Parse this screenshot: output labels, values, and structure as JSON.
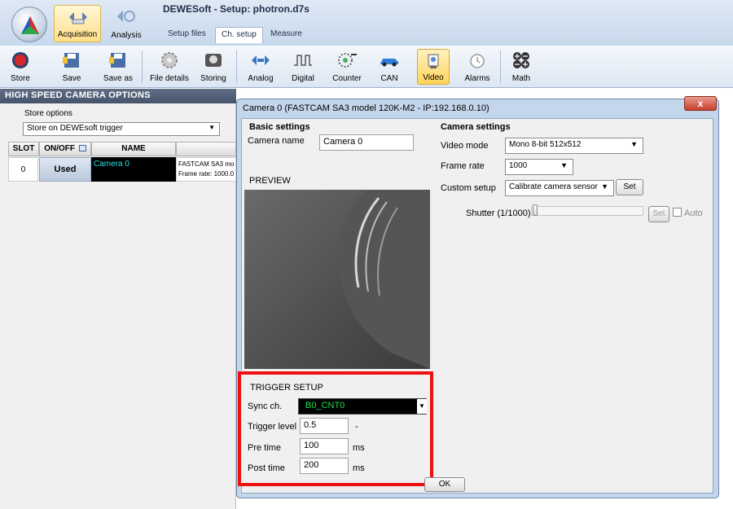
{
  "window": {
    "title": "DEWESoft - Setup: photron.d7s"
  },
  "modes": {
    "acquisition": "Acquisition",
    "analysis": "Analysis"
  },
  "ribbon_tabs": [
    "Setup files",
    "Ch. setup",
    "Measure"
  ],
  "ribbon": {
    "store": "Store",
    "save": "Save",
    "save_as": "Save as",
    "file_details": "File details",
    "storing": "Storing",
    "analog": "Analog",
    "digital": "Digital",
    "counter": "Counter",
    "can": "CAN",
    "video": "Video",
    "alarms": "Alarms",
    "math": "Math"
  },
  "left_panel": {
    "header": "HIGH SPEED CAMERA OPTIONS",
    "store_options_label": "Store options",
    "store_options_value": "Store on DEWEsoft trigger",
    "columns": [
      "SLOT",
      "ON/OFF",
      "NAME"
    ],
    "row": {
      "slot": "0",
      "status": "Used",
      "name": "Camera 0",
      "info_line1": "FASTCAM SA3 mo",
      "info_line2": "Frame rate: 1000.0"
    }
  },
  "dialog": {
    "title": "Camera  0 (FASTCAM SA3 model 120K-M2 - IP:192.168.0.10)",
    "close": "x",
    "basic_settings": "Basic settings",
    "camera_name_label": "Camera name",
    "camera_name_value": "Camera  0",
    "preview_label": "PREVIEW",
    "camera_settings": "Camera settings",
    "video_mode_label": "Video mode",
    "video_mode_value": "Mono 8-bit 512x512",
    "frame_rate_label": "Frame rate",
    "frame_rate_value": "1000",
    "custom_setup_label": "Custom setup",
    "custom_setup_value": "Calibrate camera sensor",
    "set_label": "Set",
    "shutter_label": "Shutter (1/1000)",
    "shutter_set": "Set",
    "auto_label": "Auto",
    "trigger_setup": "TRIGGER SETUP",
    "sync_label": "Sync ch.",
    "sync_value": "B0_CNT0",
    "trigger_level_label": "Trigger level",
    "trigger_level_value": "0.5",
    "trigger_level_unit": "-",
    "pre_time_label": "Pre time",
    "pre_time_value": "100",
    "post_time_label": "Post time",
    "post_time_value": "200",
    "time_unit": "ms",
    "ok": "OK"
  },
  "colors": {
    "highlight_frame": "#ee1111",
    "sync_text": "#1de34a",
    "camera_name_text": "#23e0e8"
  }
}
